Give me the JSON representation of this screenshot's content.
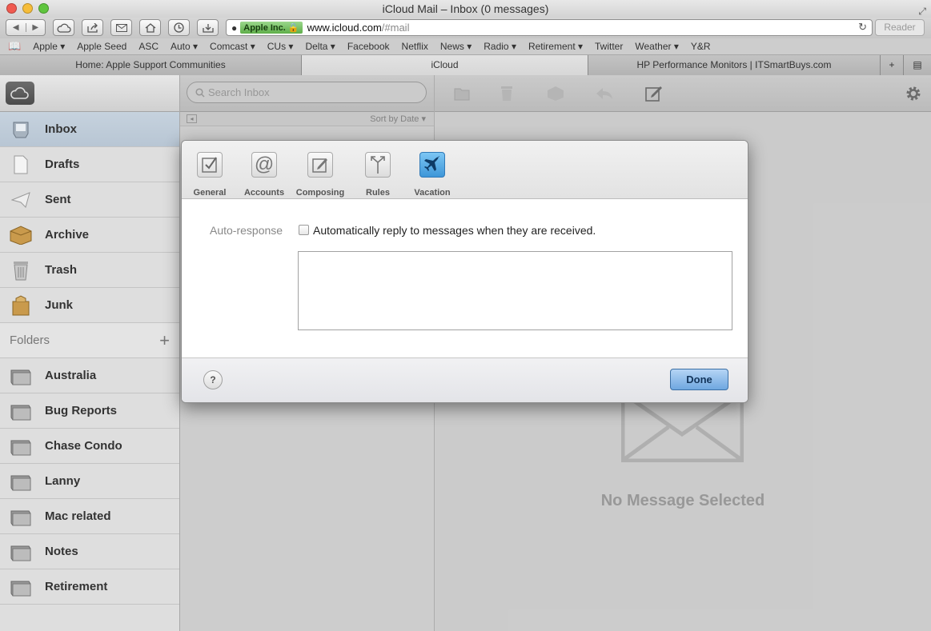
{
  "window": {
    "title": "iCloud Mail – Inbox (0 messages)"
  },
  "toolbar": {
    "ev_badge": "Apple Inc.",
    "url_host": "www.icloud.com",
    "url_path": "/#mail",
    "reader": "Reader"
  },
  "bookmarks": [
    "Apple ▾",
    "Apple Seed",
    "ASC",
    "Auto ▾",
    "Comcast ▾",
    "CUs ▾",
    "Delta ▾",
    "Facebook",
    "Netflix",
    "News ▾",
    "Radio ▾",
    "Retirement ▾",
    "Twitter",
    "Weather ▾",
    "Y&R"
  ],
  "tabs": [
    {
      "label": "Home: Apple Support Communities"
    },
    {
      "label": "iCloud"
    },
    {
      "label": "HP Performance Monitors | ITSmartBuys.com"
    }
  ],
  "sidebar": {
    "mailboxes": [
      {
        "label": "Inbox",
        "icon": "inbox-icon"
      },
      {
        "label": "Drafts",
        "icon": "drafts-icon"
      },
      {
        "label": "Sent",
        "icon": "sent-icon"
      },
      {
        "label": "Archive",
        "icon": "archive-icon"
      },
      {
        "label": "Trash",
        "icon": "trash-icon"
      },
      {
        "label": "Junk",
        "icon": "junk-icon"
      }
    ],
    "folders_label": "Folders",
    "folders": [
      {
        "label": "Australia"
      },
      {
        "label": "Bug Reports"
      },
      {
        "label": "Chase Condo"
      },
      {
        "label": "Lanny"
      },
      {
        "label": "Mac related"
      },
      {
        "label": "Notes"
      },
      {
        "label": "Retirement"
      }
    ]
  },
  "list": {
    "search_placeholder": "Search Inbox",
    "sort_label": "Sort by Date ▾"
  },
  "main": {
    "empty_text": "No Message Selected"
  },
  "dialog": {
    "tabs": [
      {
        "label": "General",
        "icon": "general-icon"
      },
      {
        "label": "Accounts",
        "icon": "accounts-icon"
      },
      {
        "label": "Composing",
        "icon": "composing-icon"
      },
      {
        "label": "Rules",
        "icon": "rules-icon"
      },
      {
        "label": "Vacation",
        "icon": "vacation-icon"
      }
    ],
    "active_tab": "Vacation",
    "auto_response_label": "Auto-response",
    "auto_response_checkbox_text": "Automatically reply to messages when they are received.",
    "auto_response_checked": false,
    "message_value": "",
    "help_label": "?",
    "done_label": "Done"
  },
  "colors": {
    "accent": "#3e96d8",
    "selected_row": "#bfccd9"
  }
}
